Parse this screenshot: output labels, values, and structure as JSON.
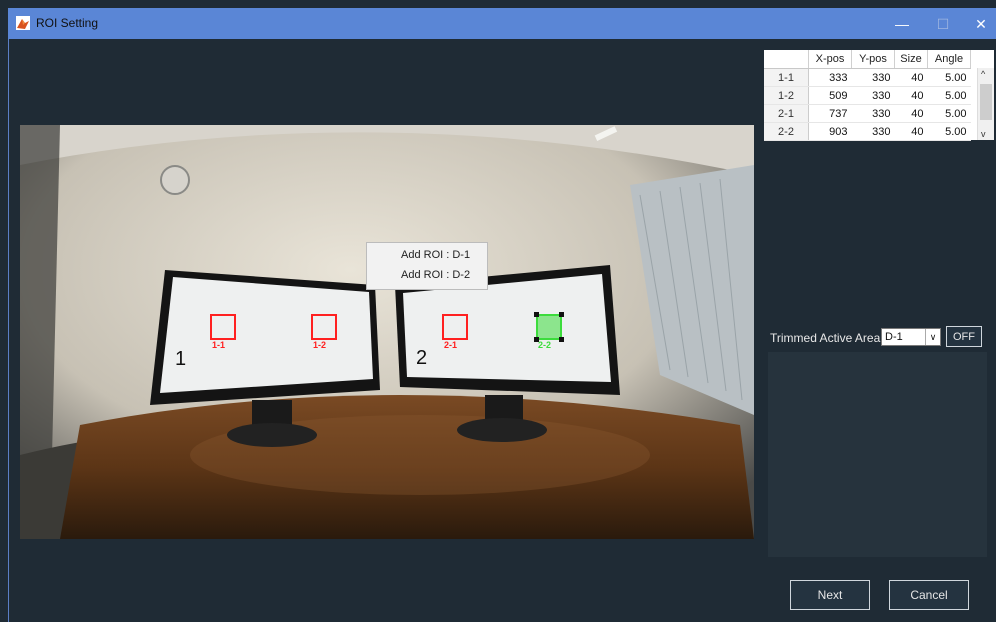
{
  "window": {
    "title": "ROI Setting",
    "controls": {
      "minimize": "—",
      "maximize": "☐",
      "close": "✕"
    }
  },
  "table": {
    "headers": [
      "",
      "X-pos",
      "Y-pos",
      "Size",
      "Angle"
    ],
    "rows": [
      {
        "id": "1-1",
        "x": "333",
        "y": "330",
        "size": "40",
        "angle": "5.00"
      },
      {
        "id": "1-2",
        "x": "509",
        "y": "330",
        "size": "40",
        "angle": "5.00"
      },
      {
        "id": "2-1",
        "x": "737",
        "y": "330",
        "size": "40",
        "angle": "5.00"
      },
      {
        "id": "2-2",
        "x": "903",
        "y": "330",
        "size": "40",
        "angle": "5.00"
      }
    ]
  },
  "scene": {
    "monitor_labels": [
      "1",
      "2"
    ],
    "roi_labels": [
      "1-1",
      "1-2",
      "2-1",
      "2-2"
    ],
    "roi_color": "#ff2020",
    "selected_roi_color": "#3cdc3c"
  },
  "context_menu": {
    "items": [
      "Add ROI : D-1",
      "Add ROI : D-2"
    ]
  },
  "trimmed": {
    "label": "Trimmed Active Area",
    "selected": "D-1",
    "toggle": "OFF"
  },
  "buttons": {
    "next": "Next",
    "cancel": "Cancel"
  }
}
